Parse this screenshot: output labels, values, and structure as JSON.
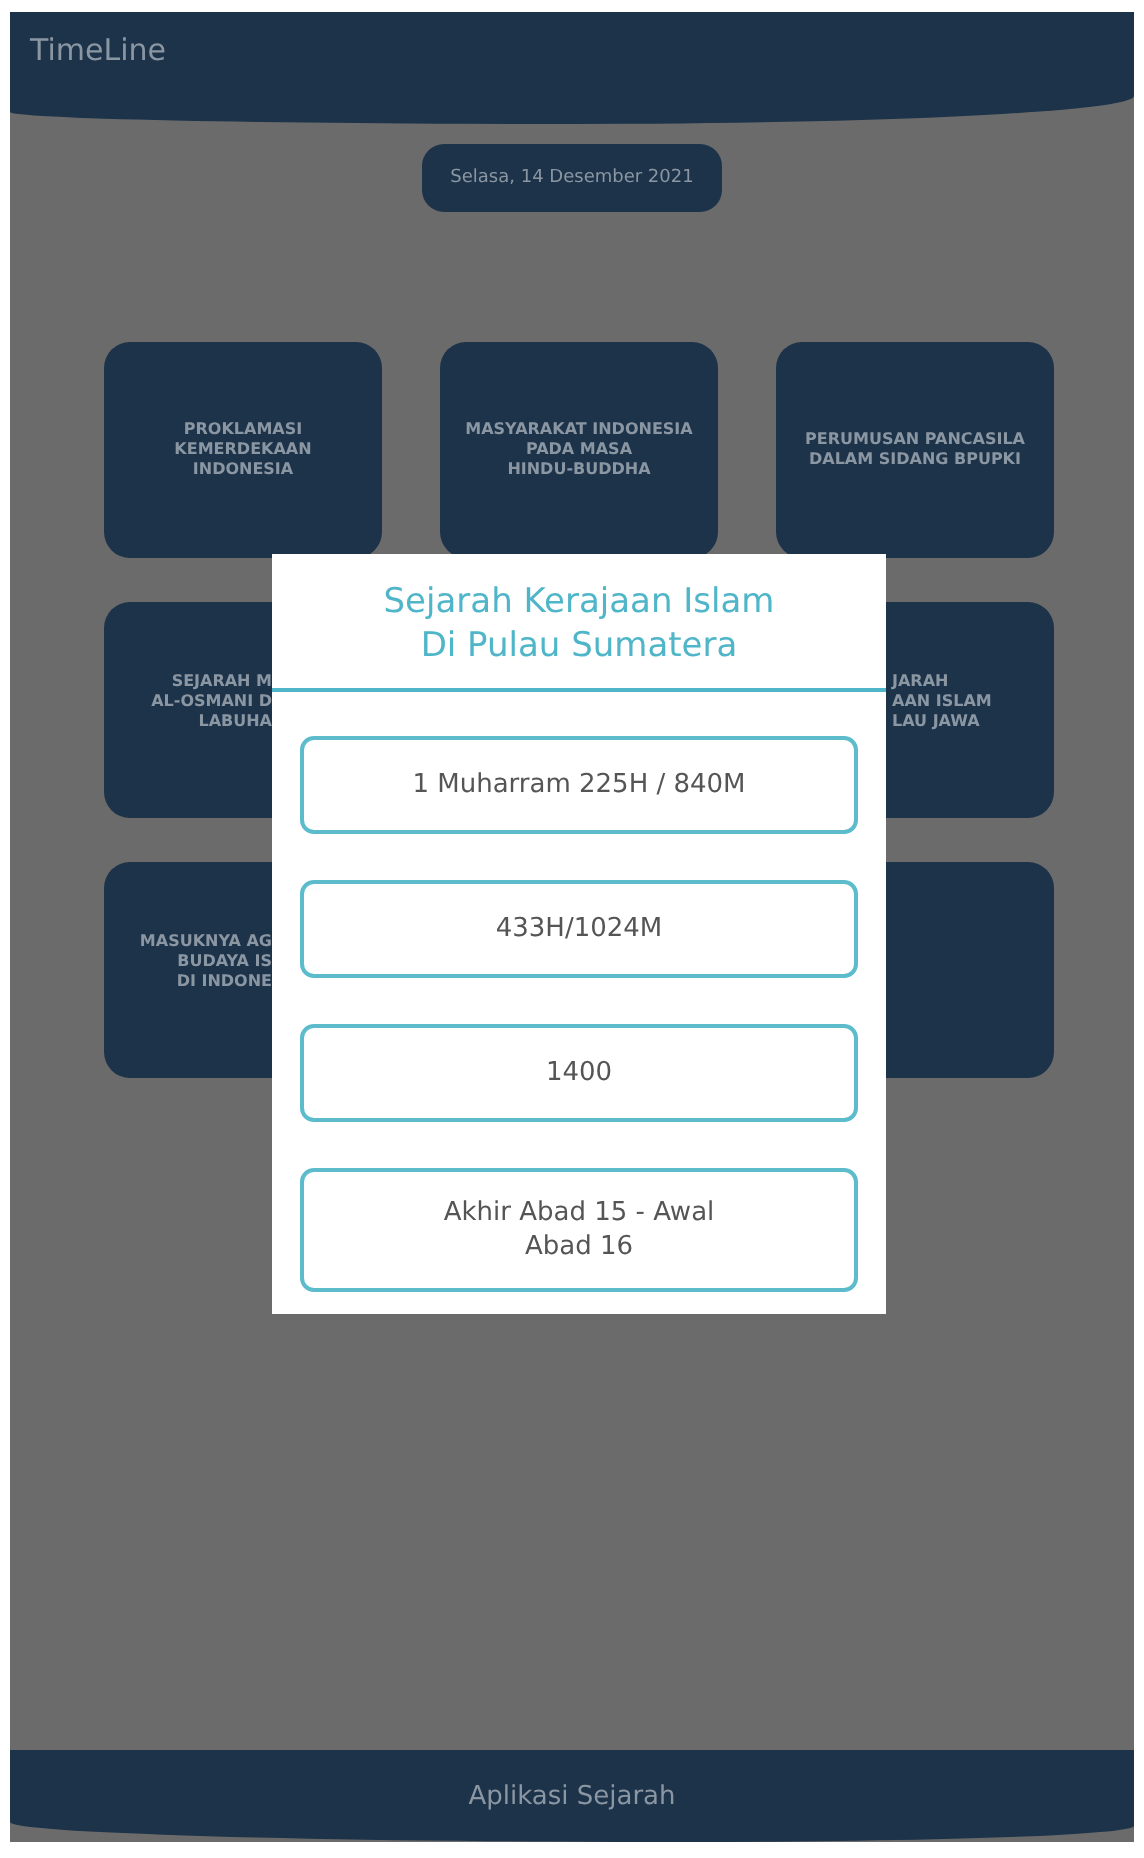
{
  "app_bar": {
    "title": "TimeLine"
  },
  "date_badge": "Selasa, 14 Desember 2021",
  "card_rows": [
    {
      "cards": [
        {
          "text": "PROKLAMASI\nKEMERDEKAAN\nINDONESIA",
          "kind": "full"
        },
        {
          "text": "MASYARAKAT INDONESIA\nPADA MASA\nHINDU-BUDDHA",
          "kind": "full"
        },
        {
          "text": "PERUMUSAN PANCASILA\nDALAM SIDANG BPUPKI",
          "kind": "full"
        }
      ]
    },
    {
      "cards": [
        {
          "text": "SEJARAH M\nAL-OSMANI D\nLABUHA",
          "kind": "cut_right"
        },
        {
          "text": "JARAH\nAAN ISLAM\nLAU JAWA",
          "kind": "cut_left"
        }
      ]
    },
    {
      "cards": [
        {
          "text": "MASUKNYA AG\nBUDAYA IS\nDI INDONE",
          "kind": "cut_right"
        },
        {
          "kind": "cut_left"
        }
      ]
    }
  ],
  "dialog": {
    "title": "Sejarah Kerajaan Islam\nDi Pulau Sumatera",
    "options": [
      "1 Muharram 225H / 840M",
      "433H/1024M",
      "1400",
      "Akhir Abad 15 - Awal\nAbad 16"
    ]
  },
  "footer": {
    "title": "Aplikasi Sejarah"
  }
}
